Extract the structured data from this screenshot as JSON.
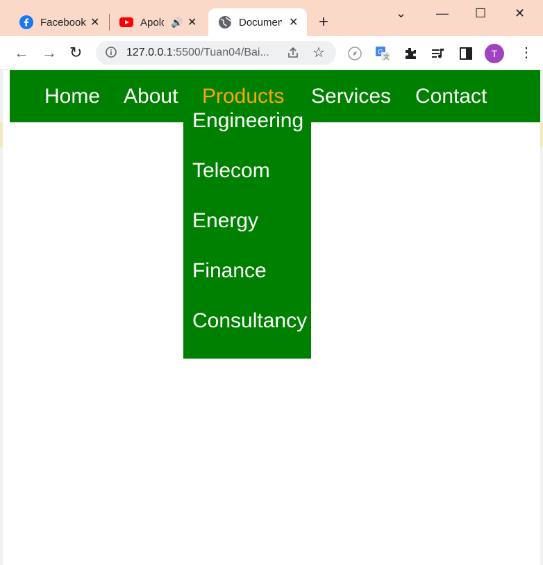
{
  "browser": {
    "tabs": [
      {
        "title": "Facebook",
        "icon": "facebook-icon",
        "active": false
      },
      {
        "title": "Apolo",
        "icon": "youtube-icon",
        "active": false,
        "audio": true
      },
      {
        "title": "Document",
        "icon": "globe-icon",
        "active": true
      }
    ],
    "url_host": "127.0.0.1",
    "url_rest": ":5500/Tuan04/Bai...",
    "profile_initial": "T"
  },
  "colors": {
    "navbar_bg": "#008000",
    "nav_text": "#ffffff",
    "nav_active": "#ffa500",
    "tabstrip_bg": "#fad9c9"
  },
  "nav": {
    "items": [
      "Home",
      "About",
      "Products",
      "Services",
      "Contact"
    ],
    "active": "Products"
  },
  "dropdown": {
    "items": [
      "Engineering",
      "Telecom",
      "Energy",
      "Finance",
      "Consultancy"
    ]
  }
}
